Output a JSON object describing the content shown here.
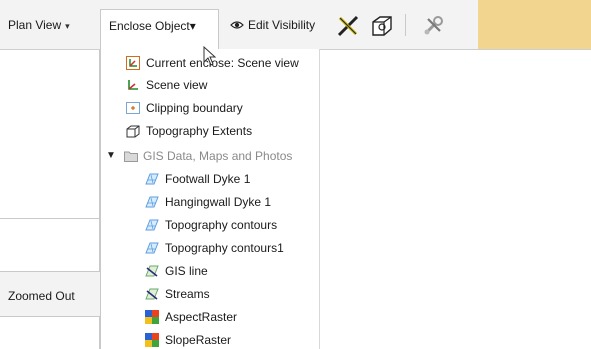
{
  "toolbar": {
    "plan_view_label": "Plan View",
    "enclose_label": "Enclose Object",
    "edit_visibility_label": "Edit Visibility",
    "caret": "▾",
    "accent_color": "#f2d58f"
  },
  "left_panel": {
    "zoomed_out_label": "Zoomed Out"
  },
  "dropdown": {
    "items": [
      {
        "label": "Current enclose: Scene view",
        "icon": "enclose-icon"
      },
      {
        "label": "Scene view",
        "icon": "axes-icon"
      },
      {
        "label": "Clipping boundary",
        "icon": "clip-box-icon"
      },
      {
        "label": "Topography Extents",
        "icon": "topo-extents-icon"
      },
      {
        "label": "GIS Data, Maps and Photos",
        "icon": "folder-icon",
        "group": true,
        "expanded": true
      },
      {
        "label": "Footwall Dyke 1",
        "icon": "surface-icon"
      },
      {
        "label": "Hangingwall Dyke 1",
        "icon": "surface-icon"
      },
      {
        "label": "Topography contours",
        "icon": "surface-icon"
      },
      {
        "label": "Topography contours1",
        "icon": "surface-icon"
      },
      {
        "label": "GIS line",
        "icon": "gis-line-icon"
      },
      {
        "label": "Streams",
        "icon": "gis-line-icon"
      },
      {
        "label": "AspectRaster",
        "icon": "raster-icon"
      },
      {
        "label": "SlopeRaster",
        "icon": "raster-icon"
      }
    ]
  }
}
